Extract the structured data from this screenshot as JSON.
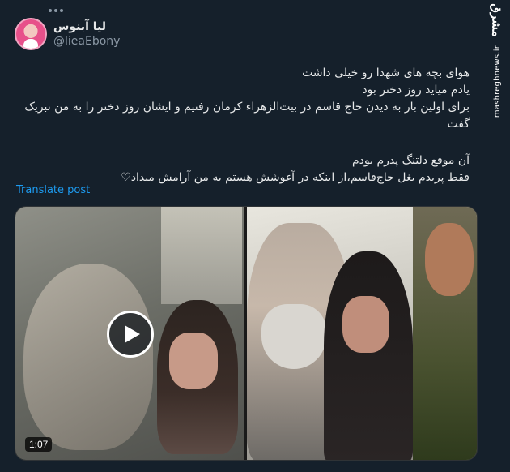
{
  "tweet": {
    "display_name": "لیا آبنوس",
    "handle": "@lieaEbony",
    "lines": [
      "هوای بچه های شهدا رو خیلی داشت",
      "یادم میاید روز دختر بود",
      "برای اولین بار به دیدن حاج قاسم در بیت‌الزهراء کرمان رفتیم و ایشان روز دختر را به من تبریک گفت",
      "",
      "آن موقع دلتنگ پدرم بودم",
      "فقط پریدم بغل حاج‌قاسم،از اینکه در آغوشش هستم به من آرامش میداد♡"
    ],
    "translate_label": "Translate post"
  },
  "media": {
    "video_duration": "1:07",
    "play_icon": "play-icon"
  },
  "watermark": {
    "logo_text": "مشرق",
    "url_text": "mashreghnews.ir"
  },
  "colors": {
    "background": "#15202b",
    "text": "#e7e9ea",
    "secondary": "#8b98a5",
    "link": "#1d9bf0"
  }
}
